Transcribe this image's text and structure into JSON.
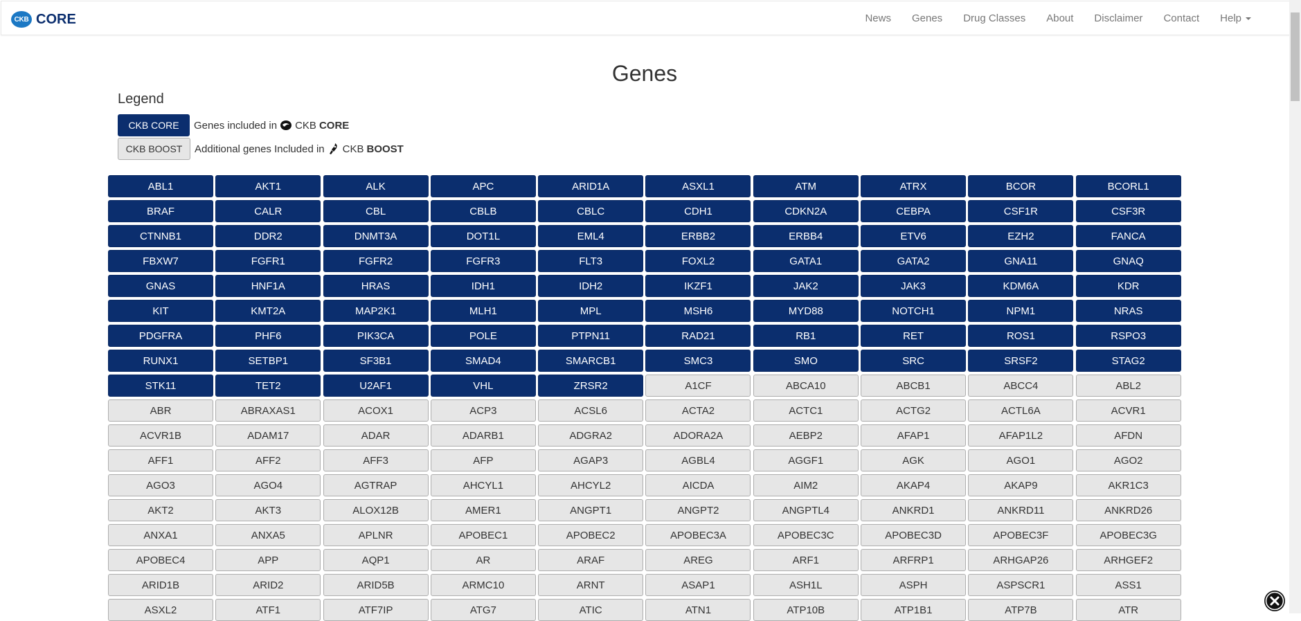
{
  "brand": {
    "logo_text": "CKB",
    "name": "CORE"
  },
  "nav": {
    "items": [
      "News",
      "Genes",
      "Drug Classes",
      "About",
      "Disclaimer",
      "Contact",
      "Help"
    ]
  },
  "title": "Genes",
  "legend": {
    "title": "Legend",
    "core_button": "CKB CORE",
    "core_text": "Genes included in",
    "core_brand_prefix": "CKB",
    "core_brand_strong": "CORE",
    "boost_button": "CKB BOOST",
    "boost_text": "Additional genes Included in",
    "boost_brand_prefix": "CKB",
    "boost_brand_strong": "BOOST"
  },
  "colors": {
    "core": "#0b2e6e",
    "boost": "#e6e6e6",
    "brand_logo": "#1b78c4"
  },
  "core_genes": [
    "ABL1",
    "AKT1",
    "ALK",
    "APC",
    "ARID1A",
    "ASXL1",
    "ATM",
    "ATRX",
    "BCOR",
    "BCORL1",
    "BRAF",
    "CALR",
    "CBL",
    "CBLB",
    "CBLC",
    "CDH1",
    "CDKN2A",
    "CEBPA",
    "CSF1R",
    "CSF3R",
    "CTNNB1",
    "DDR2",
    "DNMT3A",
    "DOT1L",
    "EML4",
    "ERBB2",
    "ERBB4",
    "ETV6",
    "EZH2",
    "FANCA",
    "FBXW7",
    "FGFR1",
    "FGFR2",
    "FGFR3",
    "FLT3",
    "FOXL2",
    "GATA1",
    "GATA2",
    "GNA11",
    "GNAQ",
    "GNAS",
    "HNF1A",
    "HRAS",
    "IDH1",
    "IDH2",
    "IKZF1",
    "JAK2",
    "JAK3",
    "KDM6A",
    "KDR",
    "KIT",
    "KMT2A",
    "MAP2K1",
    "MLH1",
    "MPL",
    "MSH6",
    "MYD88",
    "NOTCH1",
    "NPM1",
    "NRAS",
    "PDGFRA",
    "PHF6",
    "PIK3CA",
    "POLE",
    "PTPN11",
    "RAD21",
    "RB1",
    "RET",
    "ROS1",
    "RSPO3",
    "RUNX1",
    "SETBP1",
    "SF3B1",
    "SMAD4",
    "SMARCB1",
    "SMC3",
    "SMO",
    "SRC",
    "SRSF2",
    "STAG2",
    "STK11",
    "TET2",
    "U2AF1",
    "VHL",
    "ZRSR2"
  ],
  "boost_genes": [
    "A1CF",
    "ABCA10",
    "ABCB1",
    "ABCC4",
    "ABL2",
    "ABR",
    "ABRAXAS1",
    "ACOX1",
    "ACP3",
    "ACSL6",
    "ACTA2",
    "ACTC1",
    "ACTG2",
    "ACTL6A",
    "ACVR1",
    "ACVR1B",
    "ADAM17",
    "ADAR",
    "ADARB1",
    "ADGRA2",
    "ADORA2A",
    "AEBP2",
    "AFAP1",
    "AFAP1L2",
    "AFDN",
    "AFF1",
    "AFF2",
    "AFF3",
    "AFP",
    "AGAP3",
    "AGBL4",
    "AGGF1",
    "AGK",
    "AGO1",
    "AGO2",
    "AGO3",
    "AGO4",
    "AGTRAP",
    "AHCYL1",
    "AHCYL2",
    "AICDA",
    "AIM2",
    "AKAP4",
    "AKAP9",
    "AKR1C3",
    "AKT2",
    "AKT3",
    "ALOX12B",
    "AMER1",
    "ANGPT1",
    "ANGPT2",
    "ANGPTL4",
    "ANKRD1",
    "ANKRD11",
    "ANKRD26",
    "ANXA1",
    "ANXA5",
    "APLNR",
    "APOBEC1",
    "APOBEC2",
    "APOBEC3A",
    "APOBEC3C",
    "APOBEC3D",
    "APOBEC3F",
    "APOBEC3G",
    "APOBEC4",
    "APP",
    "AQP1",
    "AR",
    "ARAF",
    "AREG",
    "ARF1",
    "ARFRP1",
    "ARHGAP26",
    "ARHGEF2",
    "ARID1B",
    "ARID2",
    "ARID5B",
    "ARMC10",
    "ARNT",
    "ASAP1",
    "ASH1L",
    "ASPH",
    "ASPSCR1",
    "ASS1",
    "ASXL2",
    "ATF1",
    "ATF7IP",
    "ATG7",
    "ATIC",
    "ATN1",
    "ATP10B",
    "ATP1B1",
    "ATP7B",
    "ATR"
  ]
}
